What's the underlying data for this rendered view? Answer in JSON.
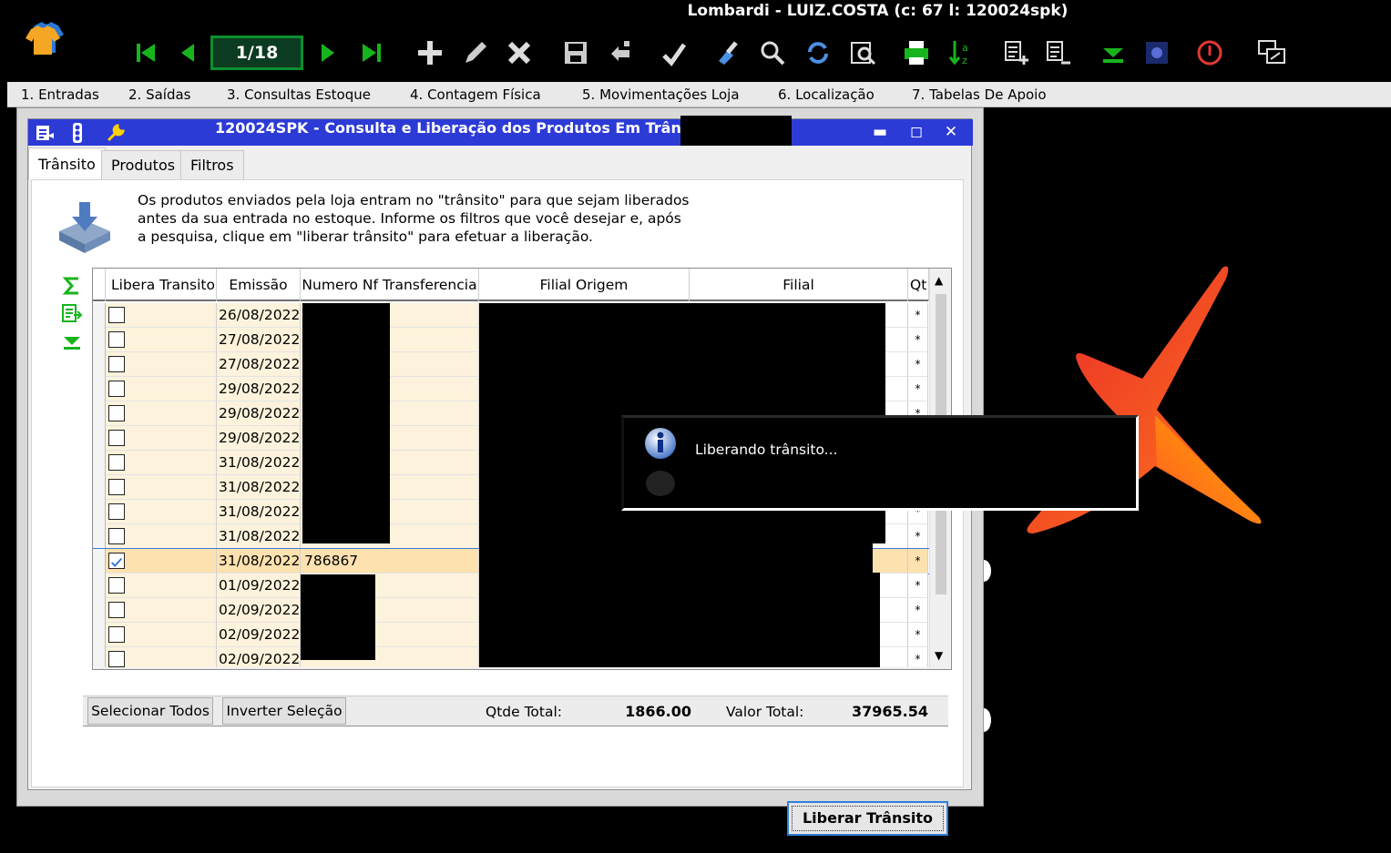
{
  "app": {
    "title": "Lombardi - LUIZ.COSTA (c: 67 l: 120024spk)",
    "page_indicator": "1/18"
  },
  "toolbar": {
    "icons": [
      "first-icon",
      "prev-icon",
      "next-icon",
      "last-icon",
      "add-icon",
      "edit-icon",
      "delete-icon",
      "save-icon",
      "duplicate-icon",
      "confirm-icon",
      "clean-icon",
      "search-icon",
      "refresh-icon",
      "preview-icon",
      "print-icon",
      "sort-icon",
      "add-list-icon",
      "list-icon",
      "collapse-icon",
      "status-icon",
      "power-icon",
      "window-switch-icon"
    ]
  },
  "menu": {
    "items": [
      {
        "label": "1. Entradas"
      },
      {
        "label": "2. Saídas"
      },
      {
        "label": "3. Consultas Estoque"
      },
      {
        "label": "4. Contagem Física"
      },
      {
        "label": "5. Movimentações Loja"
      },
      {
        "label": "6. Localização"
      },
      {
        "label": "7. Tabelas De Apoio"
      }
    ]
  },
  "window": {
    "title": "120024SPK - Consulta e Liberação dos Produtos Em Trânsito",
    "controls": {
      "minimize": "▬",
      "maximize": "◻",
      "close": "✕"
    },
    "tabs": [
      {
        "label": "Trânsito"
      },
      {
        "label": "Produtos"
      },
      {
        "label": "Filtros"
      }
    ],
    "info_text": "Os produtos enviados pela loja entram no \"trânsito\" para que sejam liberados\nantes da sua entrada no estoque. Informe os filtros que você desejar e, após\na pesquisa, clique em \"liberar trânsito\" para efetuar a liberação."
  },
  "grid": {
    "columns": [
      "Libera Transito",
      "Emissão",
      "Numero Nf Transferencia",
      "Filial Origem",
      "Filial",
      "Qt"
    ],
    "rows": [
      {
        "checked": false,
        "emissao": "26/08/2022",
        "nf": ""
      },
      {
        "checked": false,
        "emissao": "27/08/2022",
        "nf": ""
      },
      {
        "checked": false,
        "emissao": "27/08/2022",
        "nf": ""
      },
      {
        "checked": false,
        "emissao": "29/08/2022",
        "nf": ""
      },
      {
        "checked": false,
        "emissao": "29/08/2022",
        "nf": ""
      },
      {
        "checked": false,
        "emissao": "29/08/2022",
        "nf": ""
      },
      {
        "checked": false,
        "emissao": "31/08/2022",
        "nf": ""
      },
      {
        "checked": false,
        "emissao": "31/08/2022",
        "nf": ""
      },
      {
        "checked": false,
        "emissao": "31/08/2022",
        "nf": ""
      },
      {
        "checked": false,
        "emissao": "31/08/2022",
        "nf": ""
      },
      {
        "checked": true,
        "emissao": "31/08/2022",
        "nf": "786867"
      },
      {
        "checked": false,
        "emissao": "01/09/2022",
        "nf": ""
      },
      {
        "checked": false,
        "emissao": "02/09/2022",
        "nf": ""
      },
      {
        "checked": false,
        "emissao": "02/09/2022",
        "nf": ""
      },
      {
        "checked": false,
        "emissao": "02/09/2022",
        "nf": ""
      }
    ],
    "qt_marker": "*"
  },
  "bottom": {
    "select_all": "Selecionar Todos",
    "invert_selection": "Inverter Seleção",
    "qtde_label": "Qtde Total:",
    "qtde_value": "1866.00",
    "valor_label": "Valor Total:",
    "valor_value": "37965.54",
    "liberar_button": "Liberar Trânsito"
  },
  "dialog": {
    "message": "Liberando trânsito..."
  },
  "colors": {
    "titlebar": "#2c3bd6",
    "row_highlight": "#fdf3dc",
    "selected_row": "#fde2b0",
    "accent_green": "#0b8f2e"
  }
}
